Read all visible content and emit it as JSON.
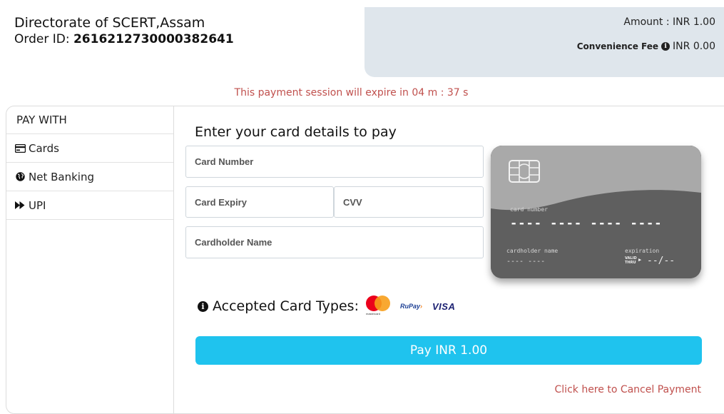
{
  "merchant": {
    "name": "Directorate of SCERT,Assam",
    "order_label": "Order ID:",
    "order_id": "261621273000038264​1"
  },
  "amount": {
    "amount_text": "Amount : INR 1.00",
    "fee_label": "Convenience Fee",
    "fee_value": "INR 0.00"
  },
  "session": {
    "text": "This payment session will expire in 04 m : 37 s"
  },
  "sidebar": {
    "heading": "PAY WITH",
    "items": [
      {
        "label": "Cards",
        "icon": "credit-card-icon"
      },
      {
        "label": "Net Banking",
        "icon": "globe-icon"
      },
      {
        "label": "UPI",
        "icon": "fast-forward-icon"
      }
    ]
  },
  "form": {
    "title": "Enter your card details to pay",
    "card_number_placeholder": "Card Number",
    "expiry_placeholder": "Card Expiry",
    "cvv_placeholder": "CVV",
    "name_placeholder": "Cardholder Name"
  },
  "card_preview": {
    "number_label": "card number",
    "number_mask": "---- ---- ---- ----",
    "holder_label": "cardholder name",
    "holder_mask": "---- ----",
    "expiry_label": "expiration",
    "valid_thru": "VALID THRU",
    "expiry_mask": "--/--"
  },
  "accepted": {
    "label": "Accepted Card Types:",
    "mastercard": "mastercard",
    "rupay": "RuPay",
    "visa": "VISA"
  },
  "actions": {
    "pay_label": "Pay INR 1.00",
    "cancel_label": "Click here to Cancel Payment"
  },
  "colors": {
    "accent": "#1fc3ee",
    "warning_text": "#c0504d",
    "amount_panel": "#dfe6ec"
  }
}
